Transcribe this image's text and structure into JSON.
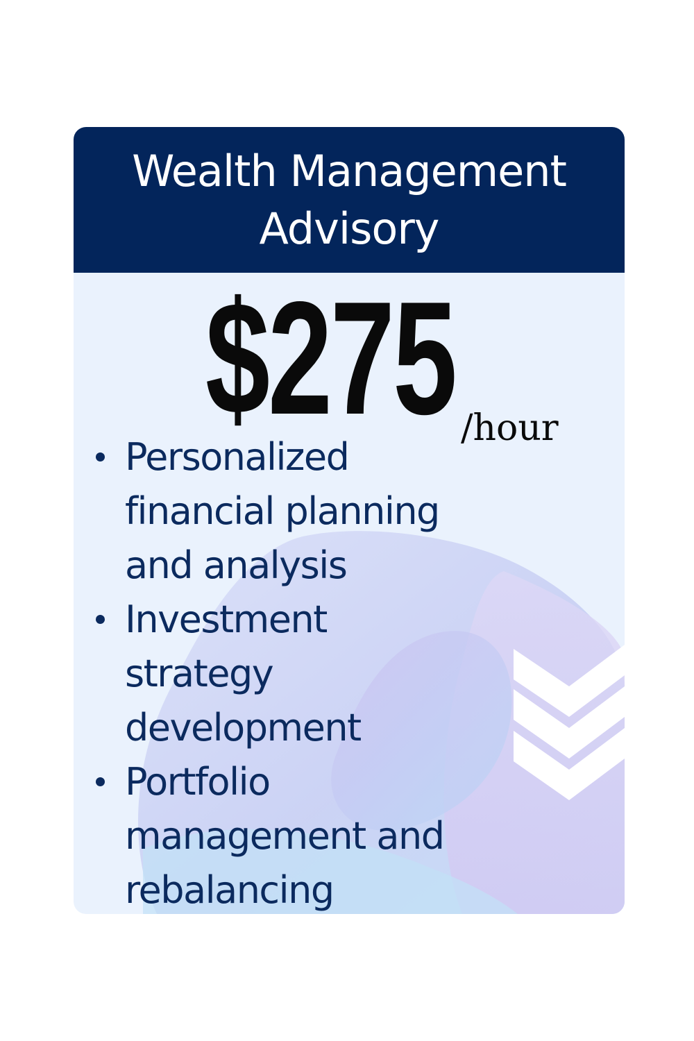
{
  "card": {
    "title": "Wealth Management Advisory",
    "price": "$275",
    "price_unit": "/hour",
    "features": [
      "Personalized financial planning and analysis",
      "Investment strategy development",
      "Portfolio management and rebalancing"
    ]
  },
  "colors": {
    "header_background": "#03255b",
    "header_text": "#ffffff",
    "card_background": "#eaf2fd",
    "price_text": "#0a0a0a",
    "feature_text": "#0b2a5e",
    "accent_purple": "#c9bdf0",
    "accent_blue": "#bcd6f7"
  },
  "icons": [
    "chevron-down-icon",
    "chevron-down-icon",
    "chevron-down-icon",
    "bullet-icon"
  ]
}
